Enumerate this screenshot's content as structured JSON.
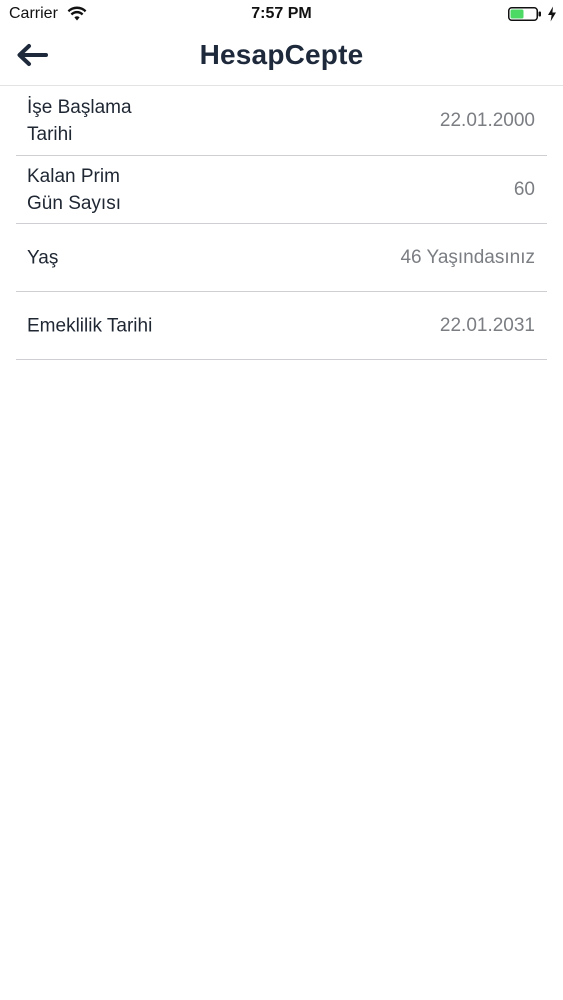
{
  "status_bar": {
    "carrier": "Carrier",
    "time": "7:57 PM",
    "battery_color": "#4cd964"
  },
  "header": {
    "title": "HesapCepte",
    "back_icon": "arrow-left-icon"
  },
  "rows": [
    {
      "label_line1": "İşe Başlama",
      "label_line2": "Tarihi",
      "value": "22.01.2000"
    },
    {
      "label_line1": "Kalan Prim",
      "label_line2": "Gün Sayısı",
      "value": "60"
    },
    {
      "label_line1": "Yaş",
      "label_line2": "",
      "value": "46 Yaşındasınız"
    },
    {
      "label_line1": "Emeklilik Tarihi",
      "label_line2": "",
      "value": "22.01.2031"
    }
  ],
  "colors": {
    "title": "#1e2a3b",
    "label": "#1f2733",
    "value": "#7a7d82",
    "divider": "#cfcfd3"
  }
}
